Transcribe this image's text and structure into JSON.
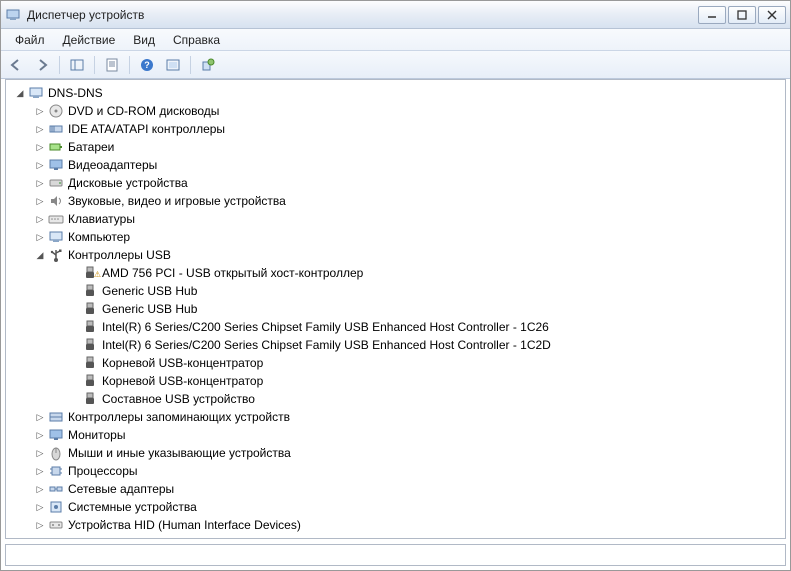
{
  "window": {
    "title": "Диспетчер устройств"
  },
  "menu": {
    "file": "Файл",
    "action": "Действие",
    "view": "Вид",
    "help": "Справка"
  },
  "tree": {
    "root": {
      "label": "DNS-DNS",
      "expanded": true
    },
    "categories": [
      {
        "key": "dvd",
        "label": "DVD и CD-ROM дисководы",
        "icon": "disc-icon",
        "expanded": false
      },
      {
        "key": "ide",
        "label": "IDE ATA/ATAPI контроллеры",
        "icon": "ide-icon",
        "expanded": false
      },
      {
        "key": "bat",
        "label": "Батареи",
        "icon": "battery-icon",
        "expanded": false
      },
      {
        "key": "vid",
        "label": "Видеоадаптеры",
        "icon": "display-icon",
        "expanded": false
      },
      {
        "key": "dsk",
        "label": "Дисковые устройства",
        "icon": "drive-icon",
        "expanded": false
      },
      {
        "key": "snd",
        "label": "Звуковые, видео и игровые устройства",
        "icon": "sound-icon",
        "expanded": false
      },
      {
        "key": "kbd",
        "label": "Клавиатуры",
        "icon": "keyboard-icon",
        "expanded": false
      },
      {
        "key": "cmp",
        "label": "Компьютер",
        "icon": "computer-icon",
        "expanded": false
      },
      {
        "key": "usb",
        "label": "Контроллеры USB",
        "icon": "usb-icon",
        "expanded": true,
        "children": [
          {
            "label": "AMD 756 PCI - USB открытый хост-контроллер",
            "icon": "usb-plug-icon",
            "warn": true
          },
          {
            "label": "Generic USB Hub",
            "icon": "usb-plug-icon",
            "warn": false
          },
          {
            "label": "Generic USB Hub",
            "icon": "usb-plug-icon",
            "warn": false
          },
          {
            "label": "Intel(R) 6 Series/C200 Series Chipset Family USB Enhanced Host Controller - 1C26",
            "icon": "usb-plug-icon",
            "warn": false
          },
          {
            "label": "Intel(R) 6 Series/C200 Series Chipset Family USB Enhanced Host Controller - 1C2D",
            "icon": "usb-plug-icon",
            "warn": false
          },
          {
            "label": "Корневой USB-концентратор",
            "icon": "usb-plug-icon",
            "warn": false
          },
          {
            "label": "Корневой USB-концентратор",
            "icon": "usb-plug-icon",
            "warn": false
          },
          {
            "label": "Составное USB устройство",
            "icon": "usb-plug-icon",
            "warn": false
          }
        ]
      },
      {
        "key": "stor",
        "label": "Контроллеры запоминающих устройств",
        "icon": "storage-icon",
        "expanded": false
      },
      {
        "key": "mon",
        "label": "Мониторы",
        "icon": "monitor-icon",
        "expanded": false
      },
      {
        "key": "mse",
        "label": "Мыши и иные указывающие устройства",
        "icon": "mouse-icon",
        "expanded": false
      },
      {
        "key": "cpu",
        "label": "Процессоры",
        "icon": "cpu-icon",
        "expanded": false
      },
      {
        "key": "net",
        "label": "Сетевые адаптеры",
        "icon": "network-icon",
        "expanded": false
      },
      {
        "key": "sys",
        "label": "Системные устройства",
        "icon": "system-icon",
        "expanded": false
      },
      {
        "key": "hid",
        "label": "Устройства HID (Human Interface Devices)",
        "icon": "hid-icon",
        "expanded": false
      }
    ]
  }
}
